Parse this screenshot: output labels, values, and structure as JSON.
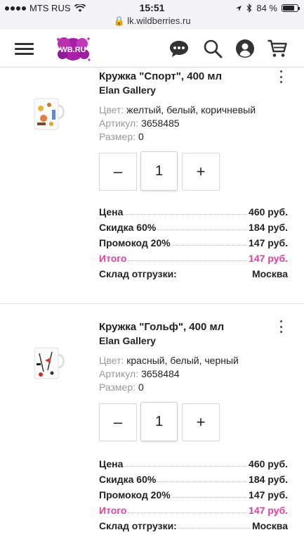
{
  "status": {
    "carrier": "MTS RUS",
    "time": "15:51",
    "url": "lk.wildberries.ru",
    "battery": "84 %"
  },
  "header": {
    "logo_text": "WB.RU"
  },
  "products": [
    {
      "title": "Кружка \"Спорт\", 400 мл",
      "brand": "Elan Gallery",
      "color_label": "Цвет:",
      "color_value": "желтый, белый, коричневый",
      "article_label": "Артикул:",
      "article_value": "3658485",
      "size_label": "Размер:",
      "size_value": "0",
      "qty_minus": "–",
      "qty_value": "1",
      "qty_plus": "+",
      "price_label": "Цена",
      "price_value": "460 руб.",
      "discount_label": "Скидка 60%",
      "discount_value": "184 руб.",
      "promo_label": "Промокод 20%",
      "promo_value": "147 руб.",
      "total_label": "Итого",
      "total_value": "147 руб.",
      "warehouse_label": "Склад отгрузки:",
      "warehouse_value": "Москва"
    },
    {
      "title": "Кружка \"Гольф\", 400 мл",
      "brand": "Elan Gallery",
      "color_label": "Цвет:",
      "color_value": "красный, белый, черный",
      "article_label": "Артикул:",
      "article_value": "3658484",
      "size_label": "Размер:",
      "size_value": "0",
      "qty_minus": "–",
      "qty_value": "1",
      "qty_plus": "+",
      "price_label": "Цена",
      "price_value": "460 руб.",
      "discount_label": "Скидка 60%",
      "discount_value": "184 руб.",
      "promo_label": "Промокод 20%",
      "promo_value": "147 руб.",
      "total_label": "Итого",
      "total_value": "147 руб.",
      "warehouse_label": "Склад отгрузки:",
      "warehouse_value": "Москва"
    }
  ],
  "colors": {
    "accent": "#e53fa4",
    "logo": "#a820a8"
  }
}
